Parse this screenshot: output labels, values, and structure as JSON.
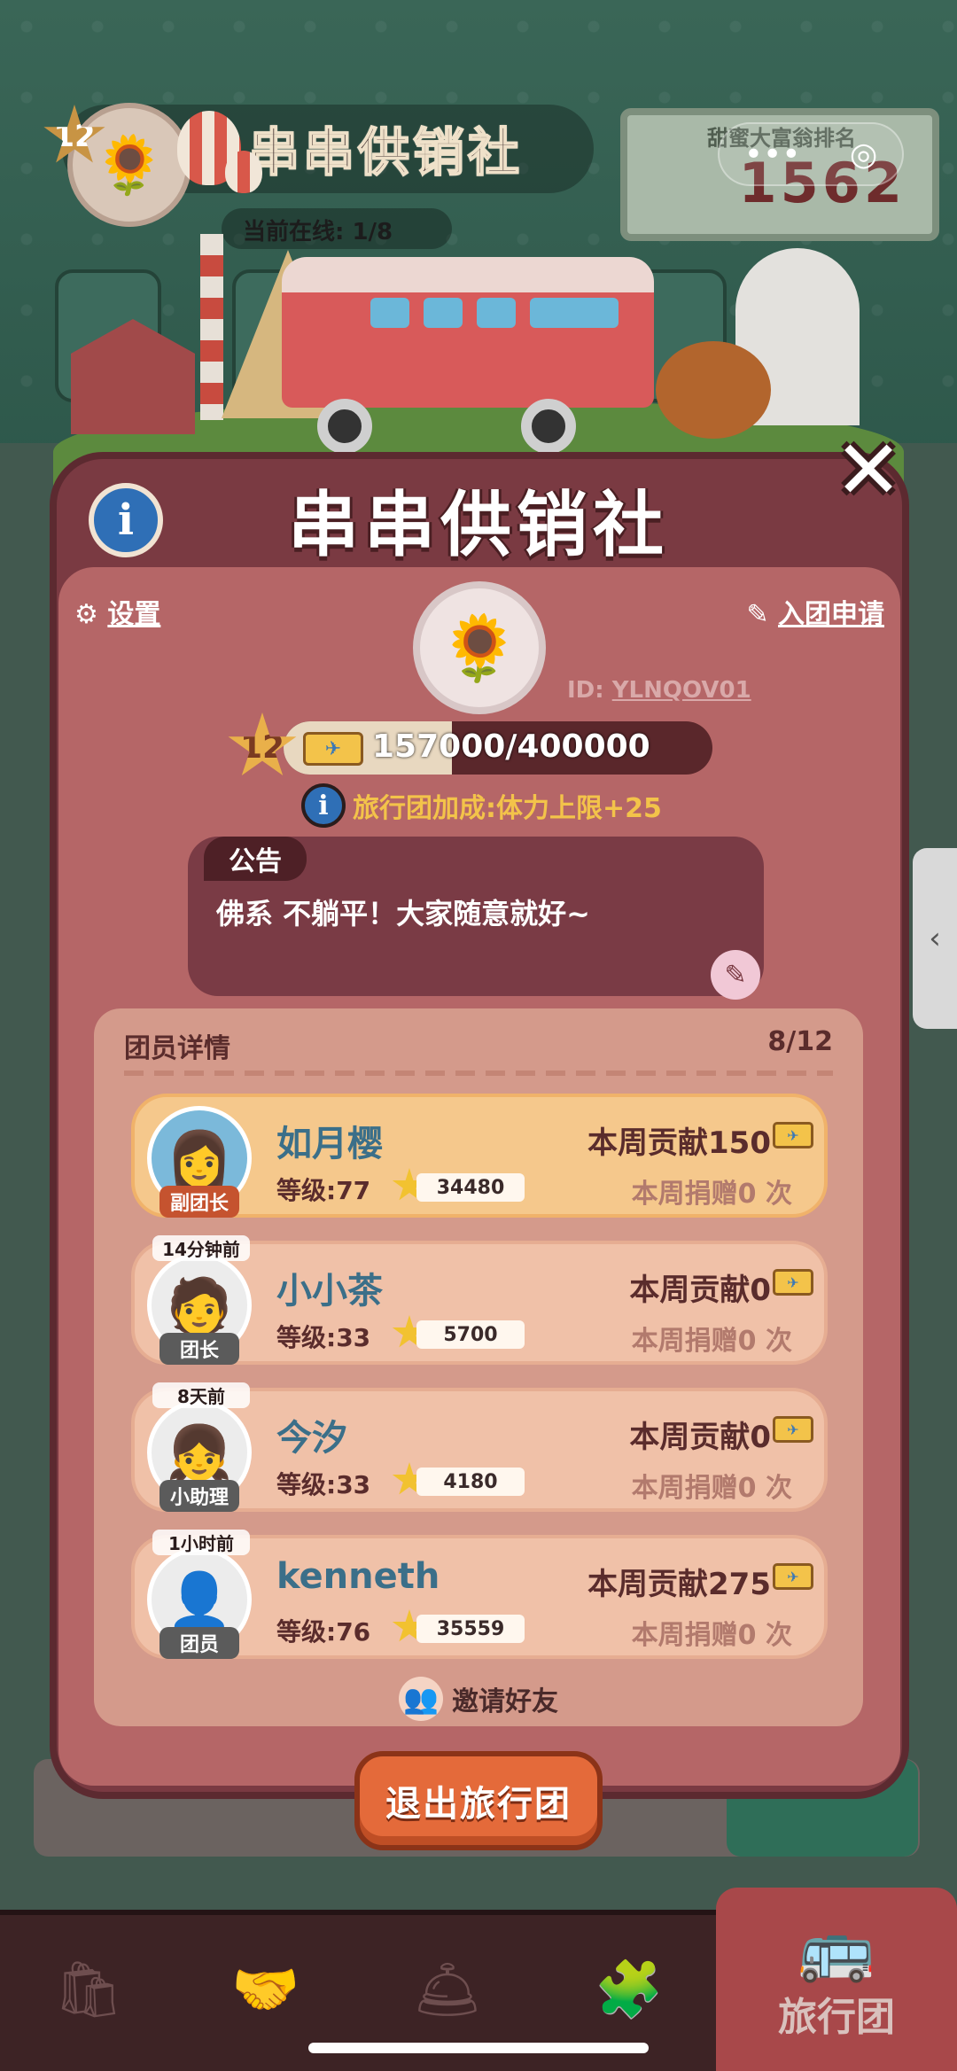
{
  "background": {
    "club_level": "12",
    "club_name": "串串供销社",
    "online_label": "当前在线: 1/8",
    "rank_label": "甜蜜大富翁排名",
    "rank_value": "1562",
    "capsule_more": "•••",
    "capsule_close": "◎"
  },
  "modal": {
    "title": "串串供销社",
    "info_icon": "i",
    "close_icon": "✕",
    "settings_label": "设置",
    "settings_icon": "⚙",
    "apply_label": "入团申请",
    "apply_icon": "✎",
    "badge_icon": "🌻",
    "id_label": "ID: ",
    "id_value": "YLNQOV01",
    "level": "12",
    "exp_text": "157000/400000",
    "exp_current": 157000,
    "exp_max": 400000,
    "bonus_icon": "i",
    "bonus_text": "旅行团加成:体力上限+25",
    "notice_tag": "公告",
    "notice_text": "佛系 不躺平！大家随意就好~",
    "edit_icon": "✎",
    "members_title": "团员详情",
    "members_count": "8/12",
    "invite_label": "邀请好友",
    "invite_icon": "👥",
    "exit_label": "退出旅行团"
  },
  "members": [
    {
      "name": "如月樱",
      "role": "副团长",
      "last_seen": "",
      "level": "等级:77",
      "stars": "34480",
      "contribution": "本周贡献150",
      "donation": "本周捐赠0 次",
      "avatar": "👩"
    },
    {
      "name": "小小茶",
      "role": "团长",
      "last_seen": "14分钟前",
      "level": "等级:33",
      "stars": "5700",
      "contribution": "本周贡献0",
      "donation": "本周捐赠0 次",
      "avatar": "🧑"
    },
    {
      "name": "今汐",
      "role": "小助理",
      "last_seen": "8天前",
      "level": "等级:33",
      "stars": "4180",
      "contribution": "本周贡献0",
      "donation": "本周捐赠0 次",
      "avatar": "👧"
    },
    {
      "name": "kenneth",
      "role": "团员",
      "last_seen": "1小时前",
      "level": "等级:76",
      "stars": "35559",
      "contribution": "本周贡献275",
      "donation": "本周捐赠0 次",
      "avatar": "👤"
    }
  ],
  "bottom_nav": {
    "active_label": "旅行团",
    "active_icon": "🚌",
    "items": [
      {
        "icon": "🛍"
      },
      {
        "icon": "🤝"
      },
      {
        "icon": "🛎"
      },
      {
        "icon": "🧩"
      }
    ]
  },
  "side_tab_icon": "‹"
}
